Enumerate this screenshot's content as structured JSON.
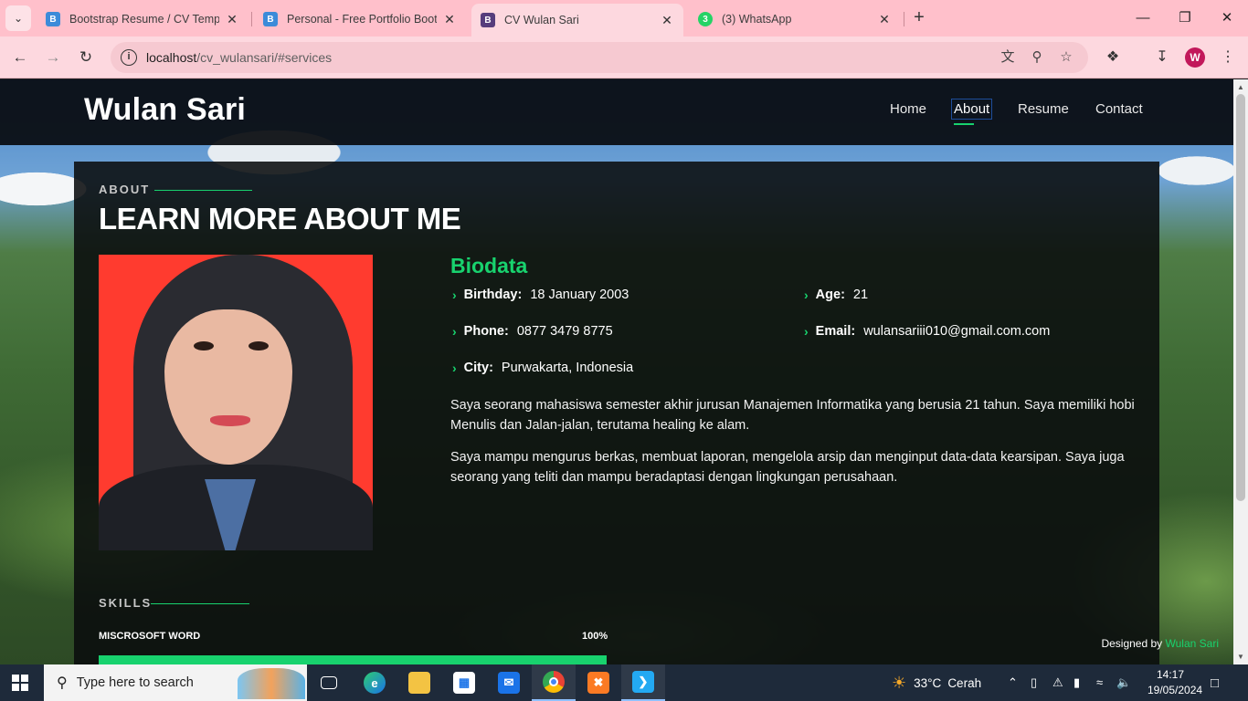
{
  "browser": {
    "tabs": [
      {
        "title": "Bootstrap Resume / CV Templat",
        "icon": "bootstrap-icon",
        "active": false
      },
      {
        "title": "Personal - Free Portfolio Bootst",
        "icon": "bootstrap-icon",
        "active": false
      },
      {
        "title": "CV Wulan Sari",
        "icon": "bootstrap-b-icon",
        "active": true
      },
      {
        "title": "(3) WhatsApp",
        "icon": "whatsapp-icon",
        "badge": "3",
        "active": false
      }
    ],
    "url_host": "localhost",
    "url_path": "/cv_wulansari/#services",
    "profile_initial": "W",
    "colors": {
      "tabbar": "#ffc0cb",
      "toolbar": "#fdd8df"
    }
  },
  "site": {
    "brand": "Wulan Sari",
    "nav": [
      {
        "label": "Home",
        "active": false
      },
      {
        "label": "About",
        "active": true
      },
      {
        "label": "Resume",
        "active": false
      },
      {
        "label": "Contact",
        "active": false
      }
    ],
    "accent": "#18d26e"
  },
  "about": {
    "label": "ABOUT",
    "title": "LEARN MORE ABOUT ME",
    "bio_title": "Biodata",
    "facts": [
      {
        "key": "Birthday:",
        "value": "18 January 2003"
      },
      {
        "key": "Age:",
        "value": "21"
      },
      {
        "key": "Phone:",
        "value": "0877 3479 8775"
      },
      {
        "key": "Email:",
        "value": "wulansariii010@gmail.com.com"
      },
      {
        "key": "City:",
        "value": "Purwakarta, Indonesia"
      }
    ],
    "paragraphs": [
      "Saya seorang mahasiswa semester akhir jurusan Manajemen Informatika yang berusia 21 tahun. Saya memiliki hobi Menulis dan Jalan-jalan, terutama healing ke alam.",
      "Saya mampu mengurus berkas, membuat laporan, mengelola arsip dan menginput data-data kearsipan. Saya juga seorang yang teliti dan mampu beradaptasi dengan lingkungan perusahaan."
    ]
  },
  "skills": {
    "label": "SKILLS",
    "items": [
      {
        "name": "MISCROSOFT WORD",
        "value_text": "100%",
        "percent": 100
      }
    ]
  },
  "footer": {
    "designed_by": "Designed by",
    "designer": "Wulan Sari"
  },
  "taskbar": {
    "search_placeholder": "Type here to search",
    "apps": [
      "task-view-icon",
      "edge-icon",
      "file-explorer-icon",
      "microsoft-store-icon",
      "mail-icon",
      "chrome-icon",
      "xampp-icon",
      "vscode-icon"
    ],
    "weather_temp": "33°C",
    "weather_text": "Cerah",
    "time": "14:17",
    "date": "19/05/2024"
  }
}
